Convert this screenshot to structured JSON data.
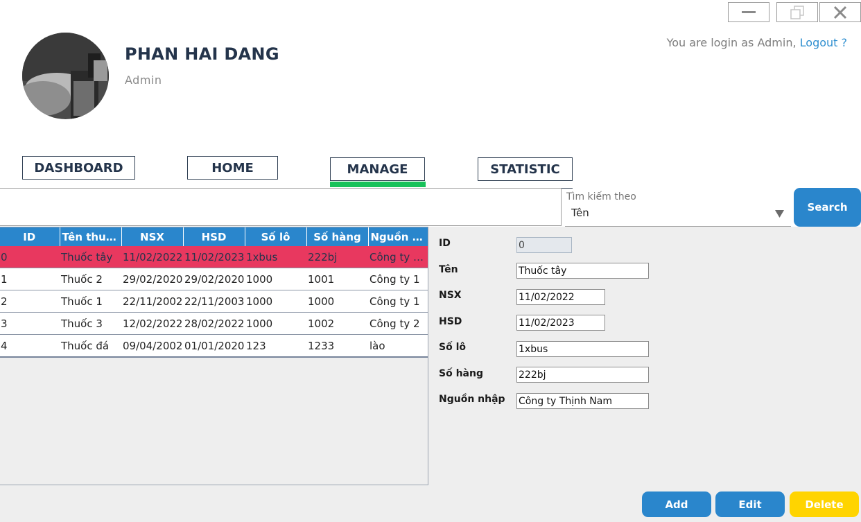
{
  "window": {
    "minimize_icon": "minimize-icon",
    "maximize_icon": "restore-icon",
    "close_icon": "close-icon"
  },
  "profile": {
    "name": "PHAN HAI DANG",
    "role": "Admin",
    "avatar_icon": "user-photo"
  },
  "session": {
    "prefix": "You are login as Admin, ",
    "logout_label": "Logout ?"
  },
  "nav": {
    "tabs": [
      {
        "label": "DASHBOARD"
      },
      {
        "label": "HOME"
      },
      {
        "label": "MANAGE",
        "active": true
      },
      {
        "label": "STATISTIC"
      }
    ]
  },
  "search": {
    "value": "",
    "by_label": "Tìm kiếm theo",
    "by_selected": "Tên",
    "button_label": "Search"
  },
  "table": {
    "columns": [
      "ID",
      "Tên thuốc",
      "NSX",
      "HSD",
      "Số lô",
      "Số hàng",
      "Nguồn nh..."
    ],
    "rows": [
      [
        "0",
        "Thuốc tây",
        "11/02/2022",
        "11/02/2023",
        "1xbus",
        "222bj",
        "Công ty Thị..."
      ],
      [
        "1",
        "Thuốc 2",
        "29/02/2020",
        "29/02/2020",
        "1000",
        "1001",
        "Công ty 1"
      ],
      [
        "2",
        "Thuốc 1",
        "22/11/2002",
        "22/11/2003",
        "1000",
        "1000",
        "Công ty 1"
      ],
      [
        "3",
        "Thuốc 3",
        "12/02/2022",
        "28/02/2022",
        "1000",
        "1002",
        "Công ty 2"
      ],
      [
        "4",
        "Thuốc đá",
        "09/04/2002",
        "01/01/2020",
        "123",
        "1233",
        "lào"
      ]
    ],
    "selected_row": 0
  },
  "form": {
    "id_label": "ID",
    "id_value": "0",
    "ten_label": "Tên",
    "ten_value": "Thuốc tây",
    "nsx_label": "NSX",
    "nsx_value": "11/02/2022",
    "hsd_label": "HSD",
    "hsd_value": "11/02/2023",
    "solo_label": "Số lô",
    "solo_value": "1xbus",
    "sohang_label": "Số hàng",
    "sohang_value": "222bj",
    "nguon_label": "Nguồn nhập",
    "nguon_value": "Công ty Thịnh Nam"
  },
  "actions": {
    "add_label": "Add",
    "edit_label": "Edit",
    "delete_label": "Delete"
  },
  "colors": {
    "accent_blue": "#2a86cc",
    "selected_row": "#e8385f",
    "active_tab_underline": "#18c25a",
    "delete_yellow": "#ffd400",
    "navy_text": "#24344b"
  }
}
